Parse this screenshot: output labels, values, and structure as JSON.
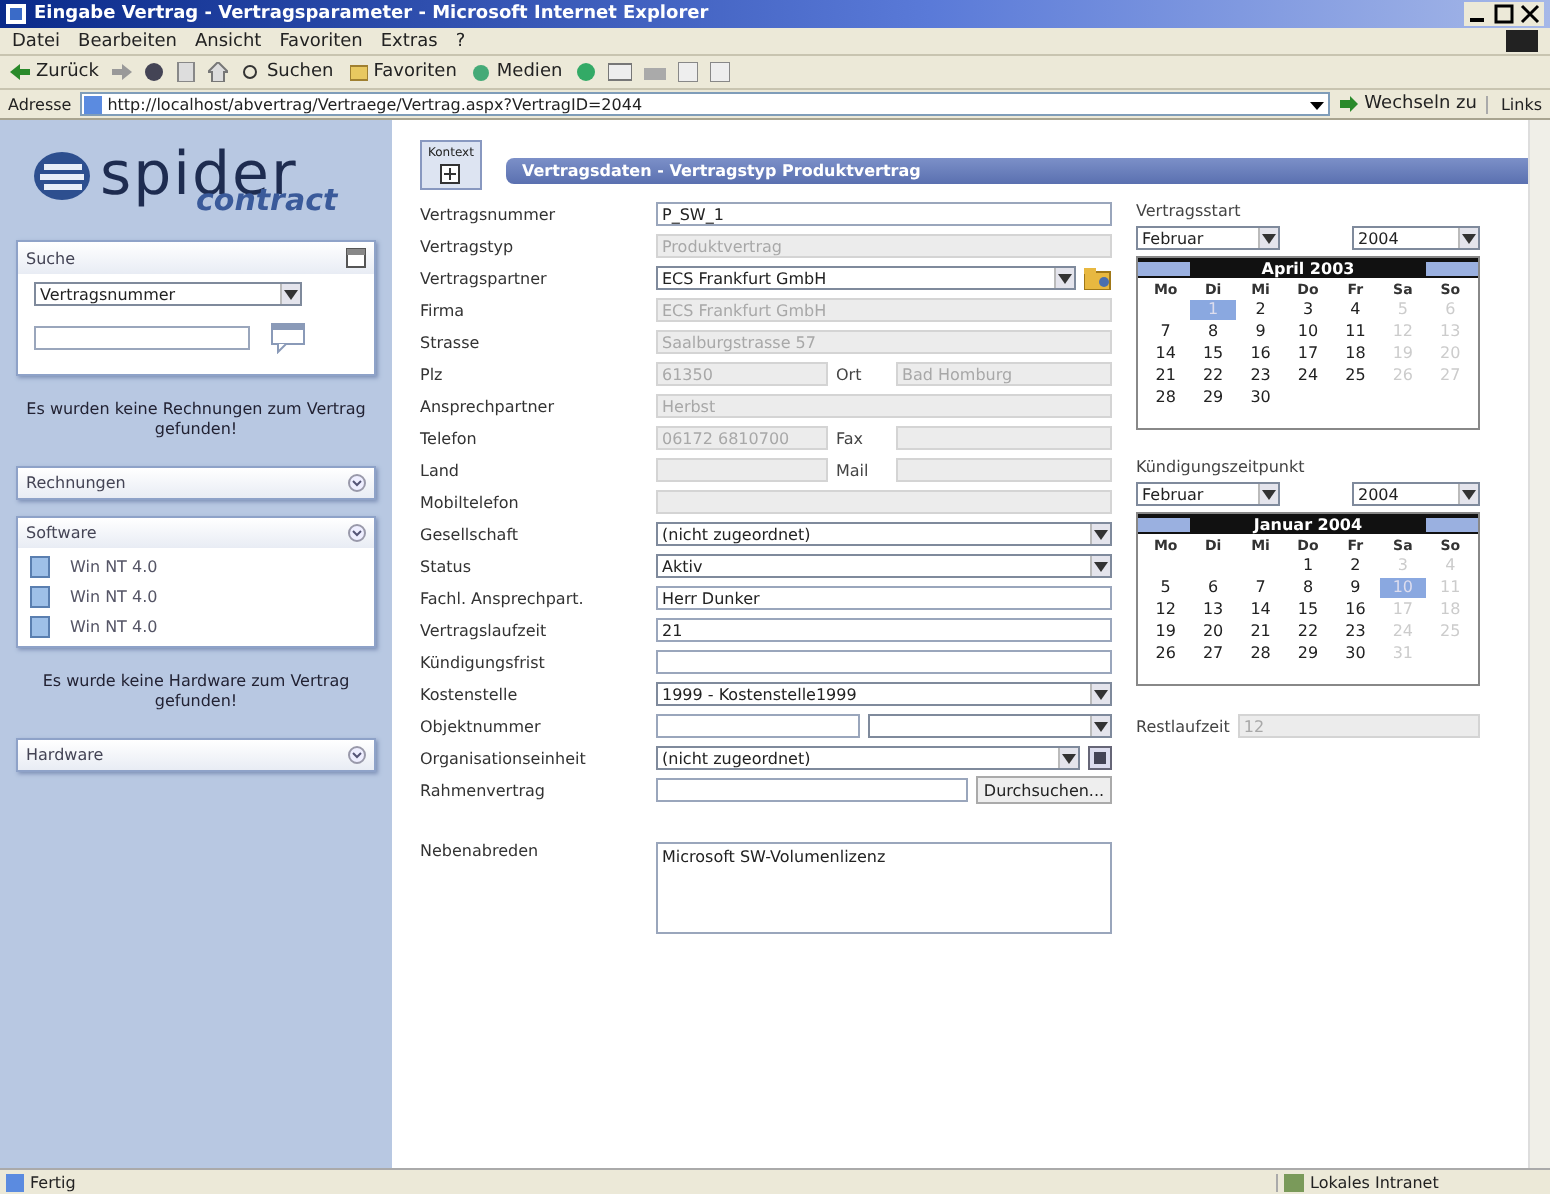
{
  "window": {
    "title": "Eingabe Vertrag - Vertragsparameter - Microsoft Internet Explorer"
  },
  "menu": [
    "Datei",
    "Bearbeiten",
    "Ansicht",
    "Favoriten",
    "Extras",
    "?"
  ],
  "toolbar": {
    "back": "Zurück",
    "search": "Suchen",
    "favorites": "Favoriten",
    "media": "Medien"
  },
  "address": {
    "label": "Adresse",
    "url": "http://localhost/abvertrag/Vertraege/Vertrag.aspx?VertragID=2044",
    "go": "Wechseln zu",
    "links": "Links"
  },
  "sidebar": {
    "logo": {
      "word": "spider",
      "sub": "contract"
    },
    "search": {
      "title": "Suche",
      "field": "Vertragsnummer"
    },
    "blocks": [
      {
        "kind": "message",
        "text": "Es wurden keine Rechnungen zum Vertrag gefunden!"
      },
      {
        "kind": "panel",
        "title": "Rechnungen"
      },
      {
        "kind": "panel",
        "title": "Software",
        "items": [
          "Win NT 4.0",
          "Win NT 4.0",
          "Win NT 4.0"
        ]
      },
      {
        "kind": "message",
        "text": "Es wurde keine Hardware zum Vertrag gefunden!"
      },
      {
        "kind": "panel",
        "title": "Hardware"
      }
    ]
  },
  "header": {
    "context": "Kontext",
    "title": "Vertragsdaten - Vertragstyp Produktvertrag"
  },
  "form": [
    {
      "label": "Vertragsnummer",
      "kind": "text",
      "value": "P_SW_1",
      "disabled": false
    },
    {
      "label": "Vertragstyp",
      "kind": "text",
      "value": "Produktvertrag",
      "disabled": true
    },
    {
      "label": "Vertragspartner",
      "kind": "select_lookup",
      "value": "ECS Frankfurt GmbH",
      "disabled": false
    },
    {
      "label": "Firma",
      "kind": "text",
      "value": "ECS Frankfurt GmbH",
      "disabled": true
    },
    {
      "label": "Strasse",
      "kind": "text",
      "value": "Saalburgstrasse 57",
      "disabled": true
    },
    {
      "label": "Plz",
      "kind": "pair",
      "value": "61350",
      "disabled": true,
      "label2": "Ort",
      "value2": "Bad Homburg"
    },
    {
      "label": "Ansprechpartner",
      "kind": "text",
      "value": "Herbst",
      "disabled": true
    },
    {
      "label": "Telefon",
      "kind": "pair",
      "value": "06172 6810700",
      "disabled": true,
      "label2": "Fax"
    },
    {
      "label": "Land",
      "kind": "pair",
      "disabled": true,
      "label2": "Mail"
    },
    {
      "label": "Mobiltelefon",
      "kind": "text",
      "disabled": true
    },
    {
      "label": "Gesellschaft",
      "kind": "select",
      "value": "(nicht zugeordnet)",
      "disabled": false
    },
    {
      "label": "Status",
      "kind": "select",
      "value": "Aktiv",
      "disabled": false
    },
    {
      "label": "Fachl. Ansprechpart.",
      "kind": "text",
      "value": "Herr Dunker",
      "disabled": false
    },
    {
      "label": "Vertragslaufzeit",
      "kind": "text",
      "value": "21",
      "disabled": false
    },
    {
      "label": "Kündigungsfrist",
      "kind": "text",
      "disabled": false
    },
    {
      "label": "Kostenstelle",
      "kind": "select",
      "value": "1999 - Kostenstelle1999",
      "disabled": false
    },
    {
      "label": "Objektnummer",
      "kind": "textselect",
      "disabled": false
    },
    {
      "label": "Organisationseinheit",
      "kind": "select_tree",
      "value": "(nicht zugeordnet)",
      "disabled": false
    },
    {
      "label": "Rahmenvertrag",
      "kind": "browse",
      "disabled": false,
      "button": "Durchsuchen..."
    },
    {
      "label": "Nebenabreden",
      "kind": "textarea",
      "value": "Microsoft SW-Volumenlizenz",
      "disabled": false
    }
  ],
  "calendars": [
    {
      "label": "Vertragsstart",
      "month": "Februar",
      "year": "2004",
      "title": "April 2003",
      "weekdays": [
        "Mo",
        "Di",
        "Mi",
        "Do",
        "Fr",
        "Sa",
        "So"
      ],
      "weeks": [
        {
          "starts_mid_week": true,
          "days": [
            {
              "day": "1",
              "weekend": false,
              "selected": true
            },
            {
              "day": "2",
              "weekend": false,
              "selected": false
            },
            {
              "day": "3",
              "weekend": false,
              "selected": false
            },
            {
              "day": "4",
              "weekend": false,
              "selected": false
            },
            {
              "day": "5",
              "weekend": true,
              "selected": false
            },
            {
              "day": "6",
              "weekend": true,
              "selected": false
            }
          ]
        },
        {
          "starts_mid_week": false,
          "days": [
            {
              "day": "7",
              "weekend": false,
              "selected": false
            },
            {
              "day": "8",
              "weekend": false,
              "selected": false
            },
            {
              "day": "9",
              "weekend": false,
              "selected": false
            },
            {
              "day": "10",
              "weekend": false,
              "selected": false
            },
            {
              "day": "11",
              "weekend": false,
              "selected": false
            },
            {
              "day": "12",
              "weekend": true,
              "selected": false
            },
            {
              "day": "13",
              "weekend": true,
              "selected": false
            }
          ]
        },
        {
          "starts_mid_week": false,
          "days": [
            {
              "day": "14",
              "weekend": false,
              "selected": false
            },
            {
              "day": "15",
              "weekend": false,
              "selected": false
            },
            {
              "day": "16",
              "weekend": false,
              "selected": false
            },
            {
              "day": "17",
              "weekend": false,
              "selected": false
            },
            {
              "day": "18",
              "weekend": false,
              "selected": false
            },
            {
              "day": "19",
              "weekend": true,
              "selected": false
            },
            {
              "day": "20",
              "weekend": true,
              "selected": false
            }
          ]
        },
        {
          "starts_mid_week": false,
          "days": [
            {
              "day": "21",
              "weekend": false,
              "selected": false
            },
            {
              "day": "22",
              "weekend": false,
              "selected": false
            },
            {
              "day": "23",
              "weekend": false,
              "selected": false
            },
            {
              "day": "24",
              "weekend": false,
              "selected": false
            },
            {
              "day": "25",
              "weekend": false,
              "selected": false
            },
            {
              "day": "26",
              "weekend": true,
              "selected": false
            },
            {
              "day": "27",
              "weekend": true,
              "selected": false
            }
          ]
        },
        {
          "starts_mid_week": false,
          "days": [
            {
              "day": "28",
              "weekend": false,
              "selected": false
            },
            {
              "day": "29",
              "weekend": false,
              "selected": false
            },
            {
              "day": "30",
              "weekend": false,
              "selected": false
            }
          ]
        }
      ]
    },
    {
      "label": "Kündigungszeitpunkt",
      "month": "Februar",
      "year": "2004",
      "title": "Januar 2004",
      "weekdays": [
        "Mo",
        "Di",
        "Mi",
        "Do",
        "Fr",
        "Sa",
        "So"
      ],
      "weeks": [
        {
          "starts_mid_week": true,
          "days": [
            {
              "day": "1",
              "weekend": false,
              "selected": false
            },
            {
              "day": "2",
              "weekend": false,
              "selected": false
            },
            {
              "day": "3",
              "weekend": true,
              "selected": false
            },
            {
              "day": "4",
              "weekend": true,
              "selected": false
            }
          ]
        },
        {
          "starts_mid_week": false,
          "days": [
            {
              "day": "5",
              "weekend": false,
              "selected": false
            },
            {
              "day": "6",
              "weekend": false,
              "selected": false
            },
            {
              "day": "7",
              "weekend": false,
              "selected": false
            },
            {
              "day": "8",
              "weekend": false,
              "selected": false
            },
            {
              "day": "9",
              "weekend": false,
              "selected": false
            },
            {
              "day": "10",
              "weekend": true,
              "selected": true
            },
            {
              "day": "11",
              "weekend": true,
              "selected": false
            }
          ]
        },
        {
          "starts_mid_week": false,
          "days": [
            {
              "day": "12",
              "weekend": false,
              "selected": false
            },
            {
              "day": "13",
              "weekend": false,
              "selected": false
            },
            {
              "day": "14",
              "weekend": false,
              "selected": false
            },
            {
              "day": "15",
              "weekend": false,
              "selected": false
            },
            {
              "day": "16",
              "weekend": false,
              "selected": false
            },
            {
              "day": "17",
              "weekend": true,
              "selected": false
            },
            {
              "day": "18",
              "weekend": true,
              "selected": false
            }
          ]
        },
        {
          "starts_mid_week": false,
          "days": [
            {
              "day": "19",
              "weekend": false,
              "selected": false
            },
            {
              "day": "20",
              "weekend": false,
              "selected": false
            },
            {
              "day": "21",
              "weekend": false,
              "selected": false
            },
            {
              "day": "22",
              "weekend": false,
              "selected": false
            },
            {
              "day": "23",
              "weekend": false,
              "selected": false
            },
            {
              "day": "24",
              "weekend": true,
              "selected": false
            },
            {
              "day": "25",
              "weekend": true,
              "selected": false
            }
          ]
        },
        {
          "starts_mid_week": false,
          "days": [
            {
              "day": "26",
              "weekend": false,
              "selected": false
            },
            {
              "day": "27",
              "weekend": false,
              "selected": false
            },
            {
              "day": "28",
              "weekend": false,
              "selected": false
            },
            {
              "day": "29",
              "weekend": false,
              "selected": false
            },
            {
              "day": "30",
              "weekend": false,
              "selected": false
            },
            {
              "day": "31",
              "weekend": true,
              "selected": false
            }
          ]
        }
      ]
    }
  ],
  "remaining": {
    "label": "Restlaufzeit",
    "value": "12"
  },
  "status_bar": {
    "text": "Fertig",
    "zone": "Lokales Intranet"
  }
}
